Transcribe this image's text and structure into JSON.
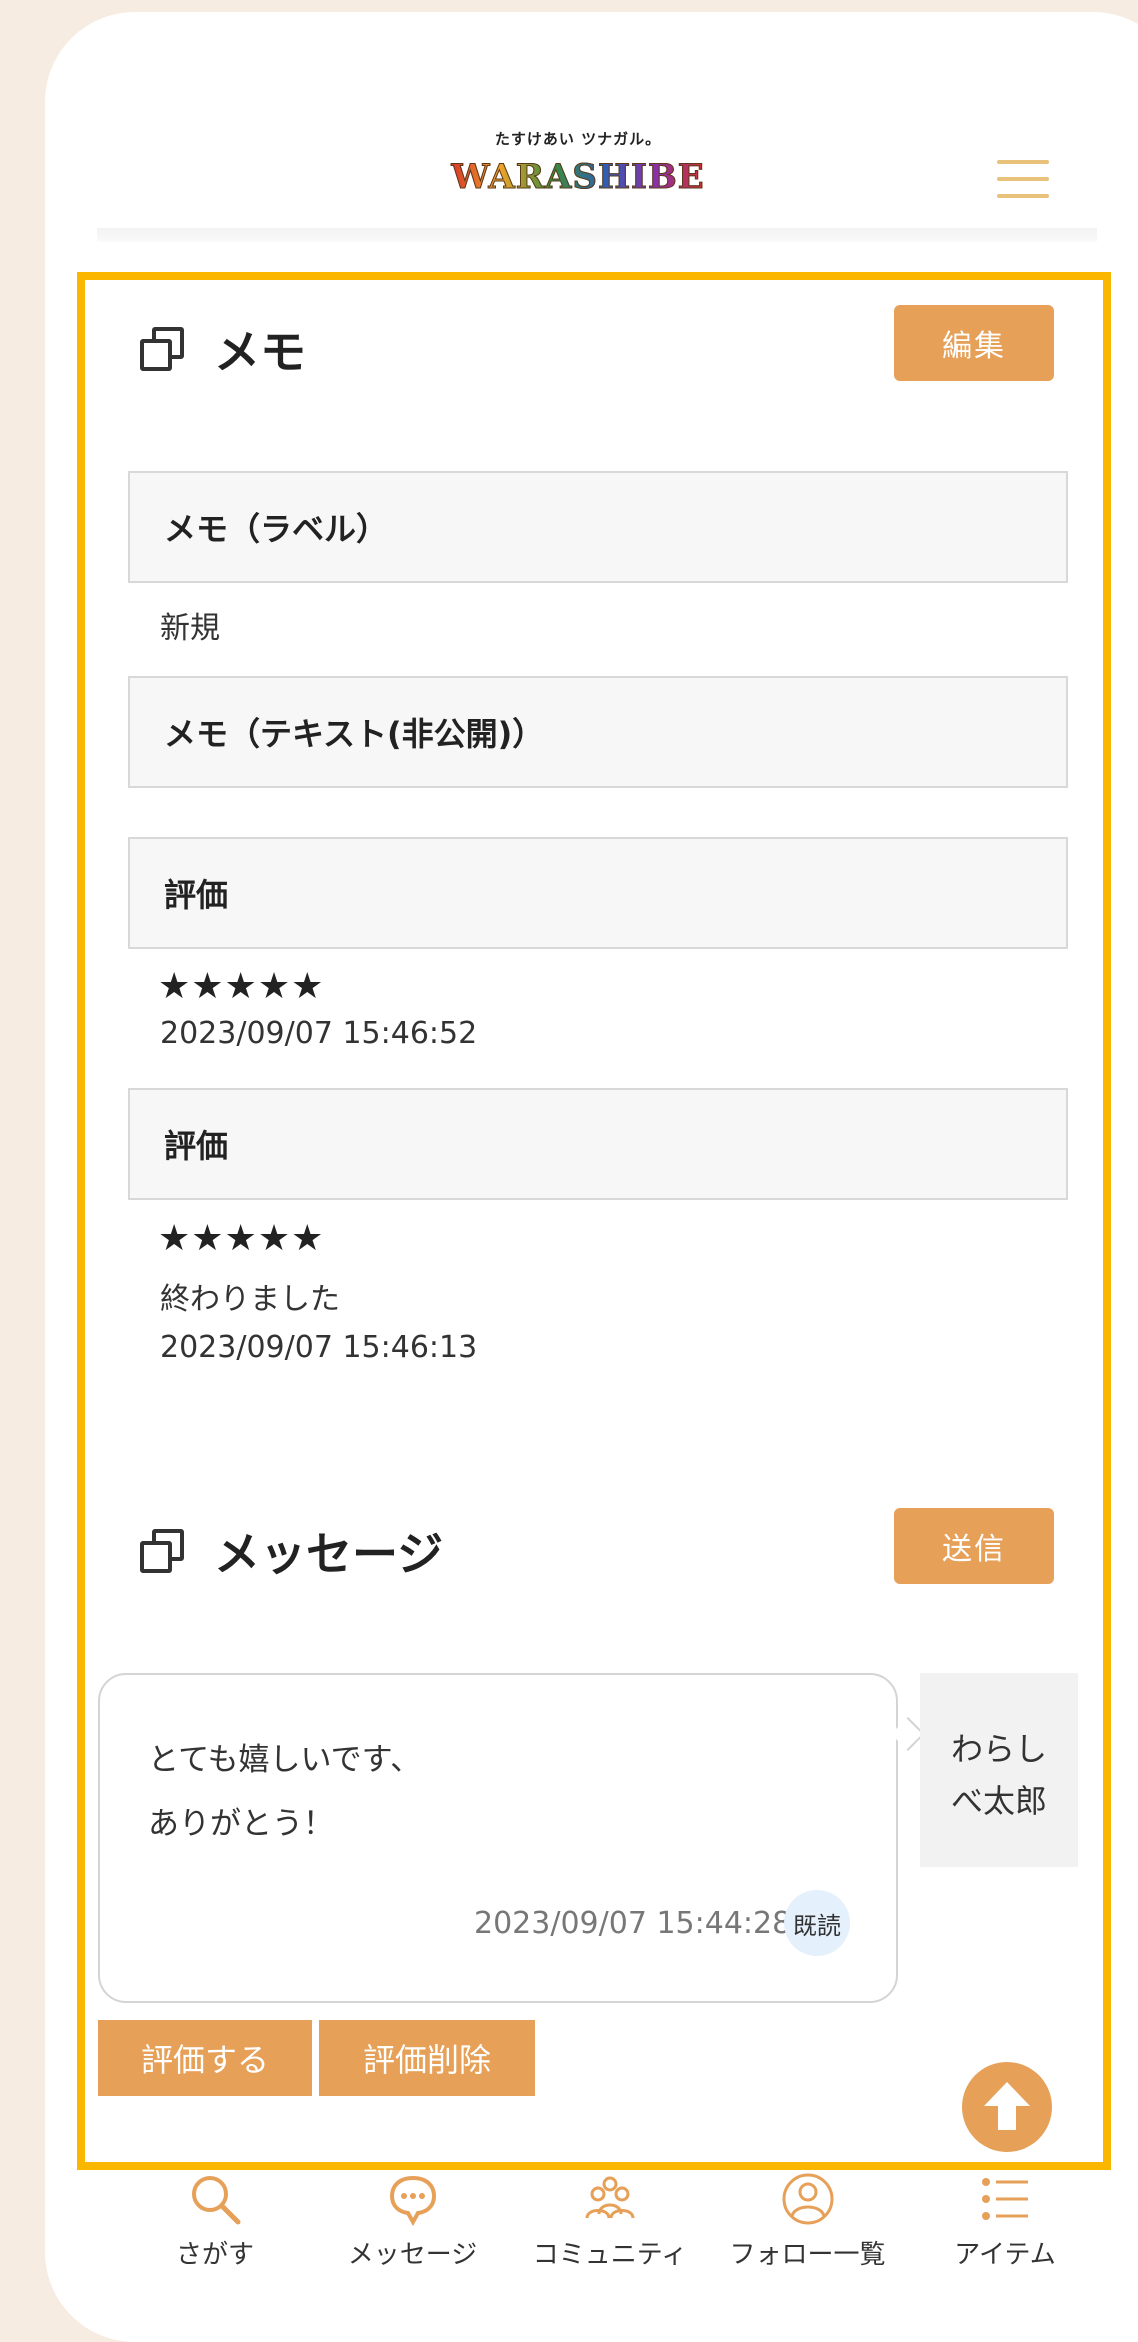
{
  "header": {
    "logo_tagline": "たすけあい ツナガル。",
    "logo_text": "WARASHIBE"
  },
  "memo": {
    "title": "メモ",
    "edit_label": "編集",
    "label_heading": "メモ（ラベル）",
    "label_value": "新規",
    "text_heading": "メモ（テキスト(非公開)）"
  },
  "reviews": [
    {
      "heading": "評価",
      "stars": "★★★★★",
      "comment": "",
      "date": "2023/09/07 15:46:52"
    },
    {
      "heading": "評価",
      "stars": "★★★★★",
      "comment": "終わりました",
      "date": "2023/09/07 15:46:13"
    }
  ],
  "messages": {
    "title": "メッセージ",
    "send_label": "送信",
    "bubble": {
      "line1": "とても嬉しいです、",
      "line2": "ありがとう！",
      "timestamp": "2023/09/07 15:44:28",
      "read_badge": "既読"
    },
    "sender_line1": "わらし",
    "sender_line2": "べ太郎",
    "rate_label": "評価する",
    "delete_rating_label": "評価削除"
  },
  "bottom_nav": [
    {
      "label": "さがす",
      "icon": "search-icon"
    },
    {
      "label": "メッセージ",
      "icon": "chat-bubble-icon"
    },
    {
      "label": "コミュニティ",
      "icon": "community-icon"
    },
    {
      "label": "フォロー一覧",
      "icon": "user-icon"
    },
    {
      "label": "アイテム",
      "icon": "list-icon"
    }
  ],
  "colors": {
    "accent": "#e6a058",
    "highlight_border": "#fbb700",
    "background": "#f7ece1"
  }
}
